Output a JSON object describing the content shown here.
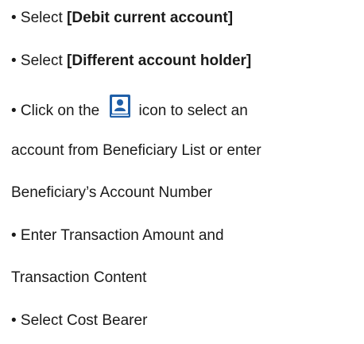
{
  "instructions": {
    "step1": {
      "prefix": "• Select ",
      "bold": "[Debit current account]"
    },
    "step2": {
      "prefix": "• Select ",
      "bold": "[Different account holder]"
    },
    "step3": {
      "before_icon": "• Click on the ",
      "after_icon": "icon to select an",
      "line2": "account from Beneficiary List or enter",
      "line3": "Beneficiary’s Account Number",
      "icon": "beneficiary-list-icon"
    },
    "step4": {
      "line1": "• Enter Transaction Amount and",
      "line2": "Transaction Content"
    },
    "step5": {
      "text": "• Select Cost Bearer"
    }
  },
  "colors": {
    "icon_blue": "#1f5fa8",
    "icon_light": "#cfe0f3",
    "text": "#1a1a1a"
  }
}
